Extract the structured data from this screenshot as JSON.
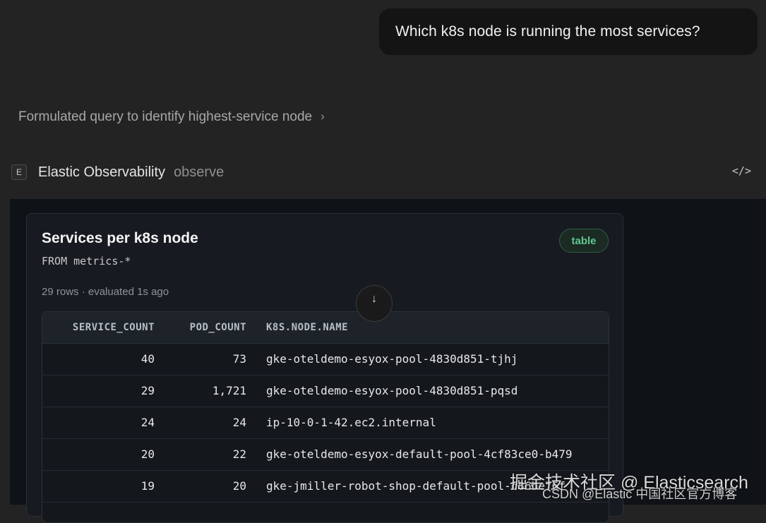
{
  "user_message": "Which k8s node is running the most services?",
  "reasoning": {
    "label": "Formulated query to identify highest-service node",
    "chevron": "chevron-right-icon"
  },
  "tool": {
    "badge": "E",
    "name": "Elastic Observability",
    "operation": "observe",
    "code_icon": "</>"
  },
  "result_card": {
    "title": "Services per k8s node",
    "query": "FROM metrics-*",
    "meta": "29 rows · evaluated 1s ago",
    "type_badge": "table",
    "type_badge_color": "#5fc78e",
    "columns": [
      "SERVICE_COUNT",
      "POD_COUNT",
      "K8S.NODE.NAME"
    ],
    "rows": [
      [
        "40",
        "73",
        "gke-oteldemo-esyox-pool-4830d851-tjhj"
      ],
      [
        "29",
        "1,721",
        "gke-oteldemo-esyox-pool-4830d851-pqsd"
      ],
      [
        "24",
        "24",
        "ip-10-0-1-42.ec2.internal"
      ],
      [
        "20",
        "22",
        "gke-oteldemo-esyox-default-pool-4cf83ce0-b479"
      ],
      [
        "19",
        "20",
        "gke-jmiller-robot-shop-default-pool-d86be76f"
      ]
    ]
  },
  "scroll_button_icon": "arrow-down-icon",
  "watermark": {
    "line1": "掘金技术社区 @ Elasticsearch",
    "line2": "CSDN @Elastic 中国社区官方博客"
  }
}
